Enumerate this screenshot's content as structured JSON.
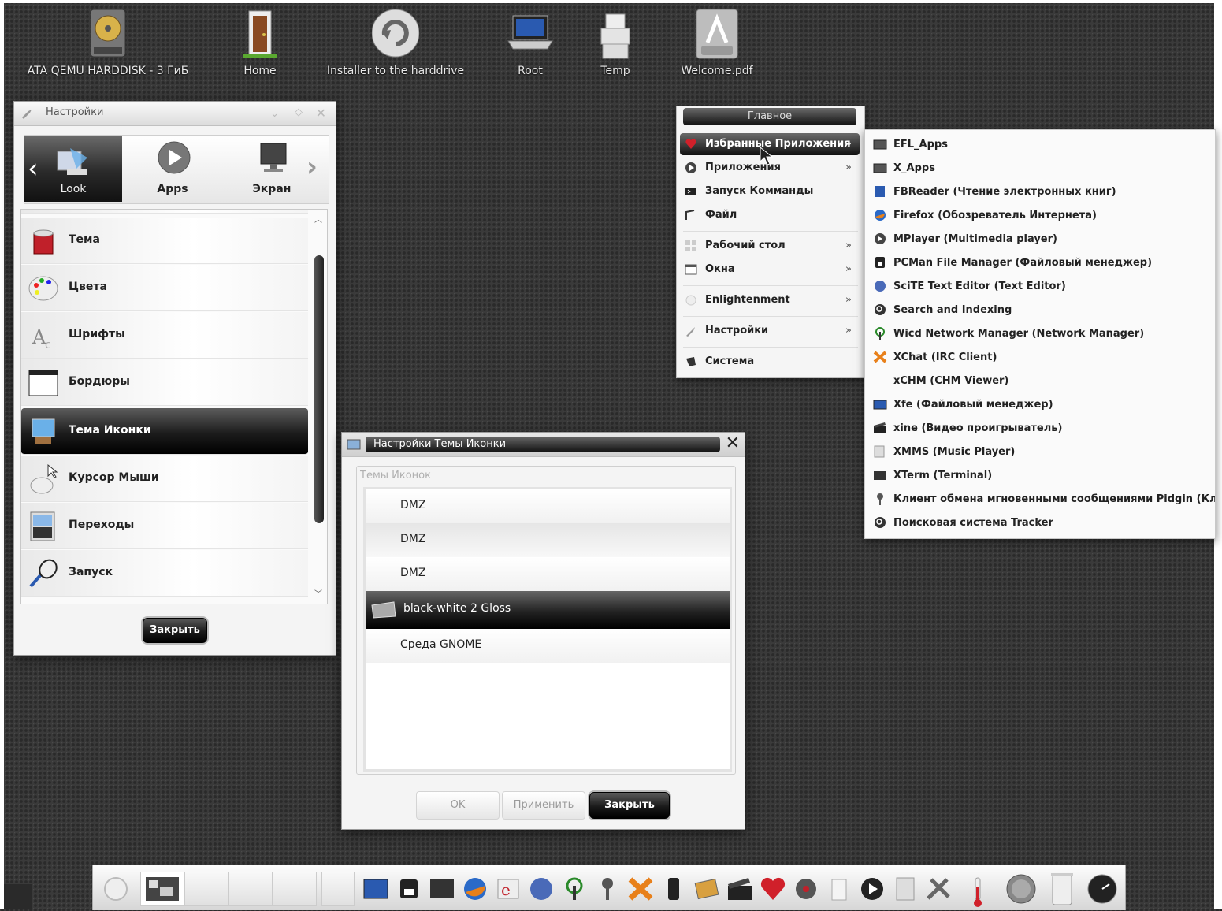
{
  "desktop": {
    "icons": [
      {
        "label": "ATA QEMU HARDDISK - 3 ГиБ",
        "icon": "harddisk-icon"
      },
      {
        "label": "Home",
        "icon": "door-icon"
      },
      {
        "label": "Installer to the harddrive",
        "icon": "installer-icon"
      },
      {
        "label": "Root",
        "icon": "laptop-icon"
      },
      {
        "label": "Temp",
        "icon": "boxes-icon"
      },
      {
        "label": "Welcome.pdf",
        "icon": "pdf-icon"
      }
    ]
  },
  "settings": {
    "title": "Настройки",
    "categories": [
      {
        "label": "Look",
        "active": true
      },
      {
        "label": "Apps",
        "active": false
      },
      {
        "label": "Экран",
        "active": false
      }
    ],
    "items": [
      {
        "label": "Тема"
      },
      {
        "label": "Цвета"
      },
      {
        "label": "Шрифты"
      },
      {
        "label": "Бордюры"
      },
      {
        "label": "Тема Иконки",
        "selected": true
      },
      {
        "label": "Курсор Мыши"
      },
      {
        "label": "Переходы"
      },
      {
        "label": "Запуск"
      }
    ],
    "close_label": "Закрыть"
  },
  "icon_theme_dialog": {
    "title": "Настройки Темы Иконки",
    "group_label": "Темы Иконок",
    "themes": [
      {
        "label": "DMZ"
      },
      {
        "label": "DMZ"
      },
      {
        "label": "DMZ"
      },
      {
        "label": "black-white 2 Gloss",
        "selected": true
      },
      {
        "label": "Среда GNOME"
      }
    ],
    "buttons": {
      "ok": "OK",
      "apply": "Применить",
      "close": "Закрыть"
    }
  },
  "main_menu": {
    "header": "Главное",
    "items": [
      {
        "label": "Избранные Приложения",
        "submenu": true,
        "selected": true
      },
      {
        "label": "Приложения",
        "submenu": true
      },
      {
        "label": "Запуск Комманды",
        "submenu": false
      },
      {
        "label": "Файл",
        "submenu": false
      },
      {
        "label": "Рабочий стол",
        "submenu": true
      },
      {
        "label": "Окна",
        "submenu": true
      },
      {
        "label": "Enlightenment",
        "submenu": true
      },
      {
        "label": "Настройки",
        "submenu": true
      },
      {
        "label": "Система",
        "submenu": false
      }
    ],
    "arrow": "»"
  },
  "favorites_submenu": {
    "items": [
      {
        "label": "EFL_Apps",
        "icon": "folder-icon"
      },
      {
        "label": "X_Apps",
        "icon": "folder-icon"
      },
      {
        "label": "FBReader (Чтение электронных книг)",
        "icon": "book-icon"
      },
      {
        "label": "Firefox (Обозреватель Интернета)",
        "icon": "firefox-icon"
      },
      {
        "label": "MPlayer (Multimedia player)",
        "icon": "mplayer-icon"
      },
      {
        "label": "PCMan File Manager (Файловый менеджер)",
        "icon": "file-manager-icon"
      },
      {
        "label": "SciTE Text Editor (Text Editor)",
        "icon": "globe-icon"
      },
      {
        "label": "Search and Indexing",
        "icon": "search-icon"
      },
      {
        "label": "Wicd Network Manager (Network Manager)",
        "icon": "antenna-icon"
      },
      {
        "label": "XChat (IRC Client)",
        "icon": "xchat-icon"
      },
      {
        "label": "xCHM (CHM Viewer)",
        "icon": "blank-icon"
      },
      {
        "label": "Xfe (Файловый менеджер)",
        "icon": "window-icon"
      },
      {
        "label": "xine (Видео проигрыватель)",
        "icon": "clapper-icon"
      },
      {
        "label": "XMMS (Music Player)",
        "icon": "player-icon"
      },
      {
        "label": "XTerm (Terminal)",
        "icon": "terminal-icon"
      },
      {
        "label": "Клиент обмена мгновенными сообщениями Pidgin (Клиент",
        "icon": "pidgin-icon"
      },
      {
        "label": "Поисковая система Tracker",
        "icon": "search-icon"
      }
    ]
  },
  "colors": {
    "accent_dark": "#1a1a1a",
    "desktop_bg": "#3a3a3a",
    "favorite_red": "#d0202a"
  }
}
